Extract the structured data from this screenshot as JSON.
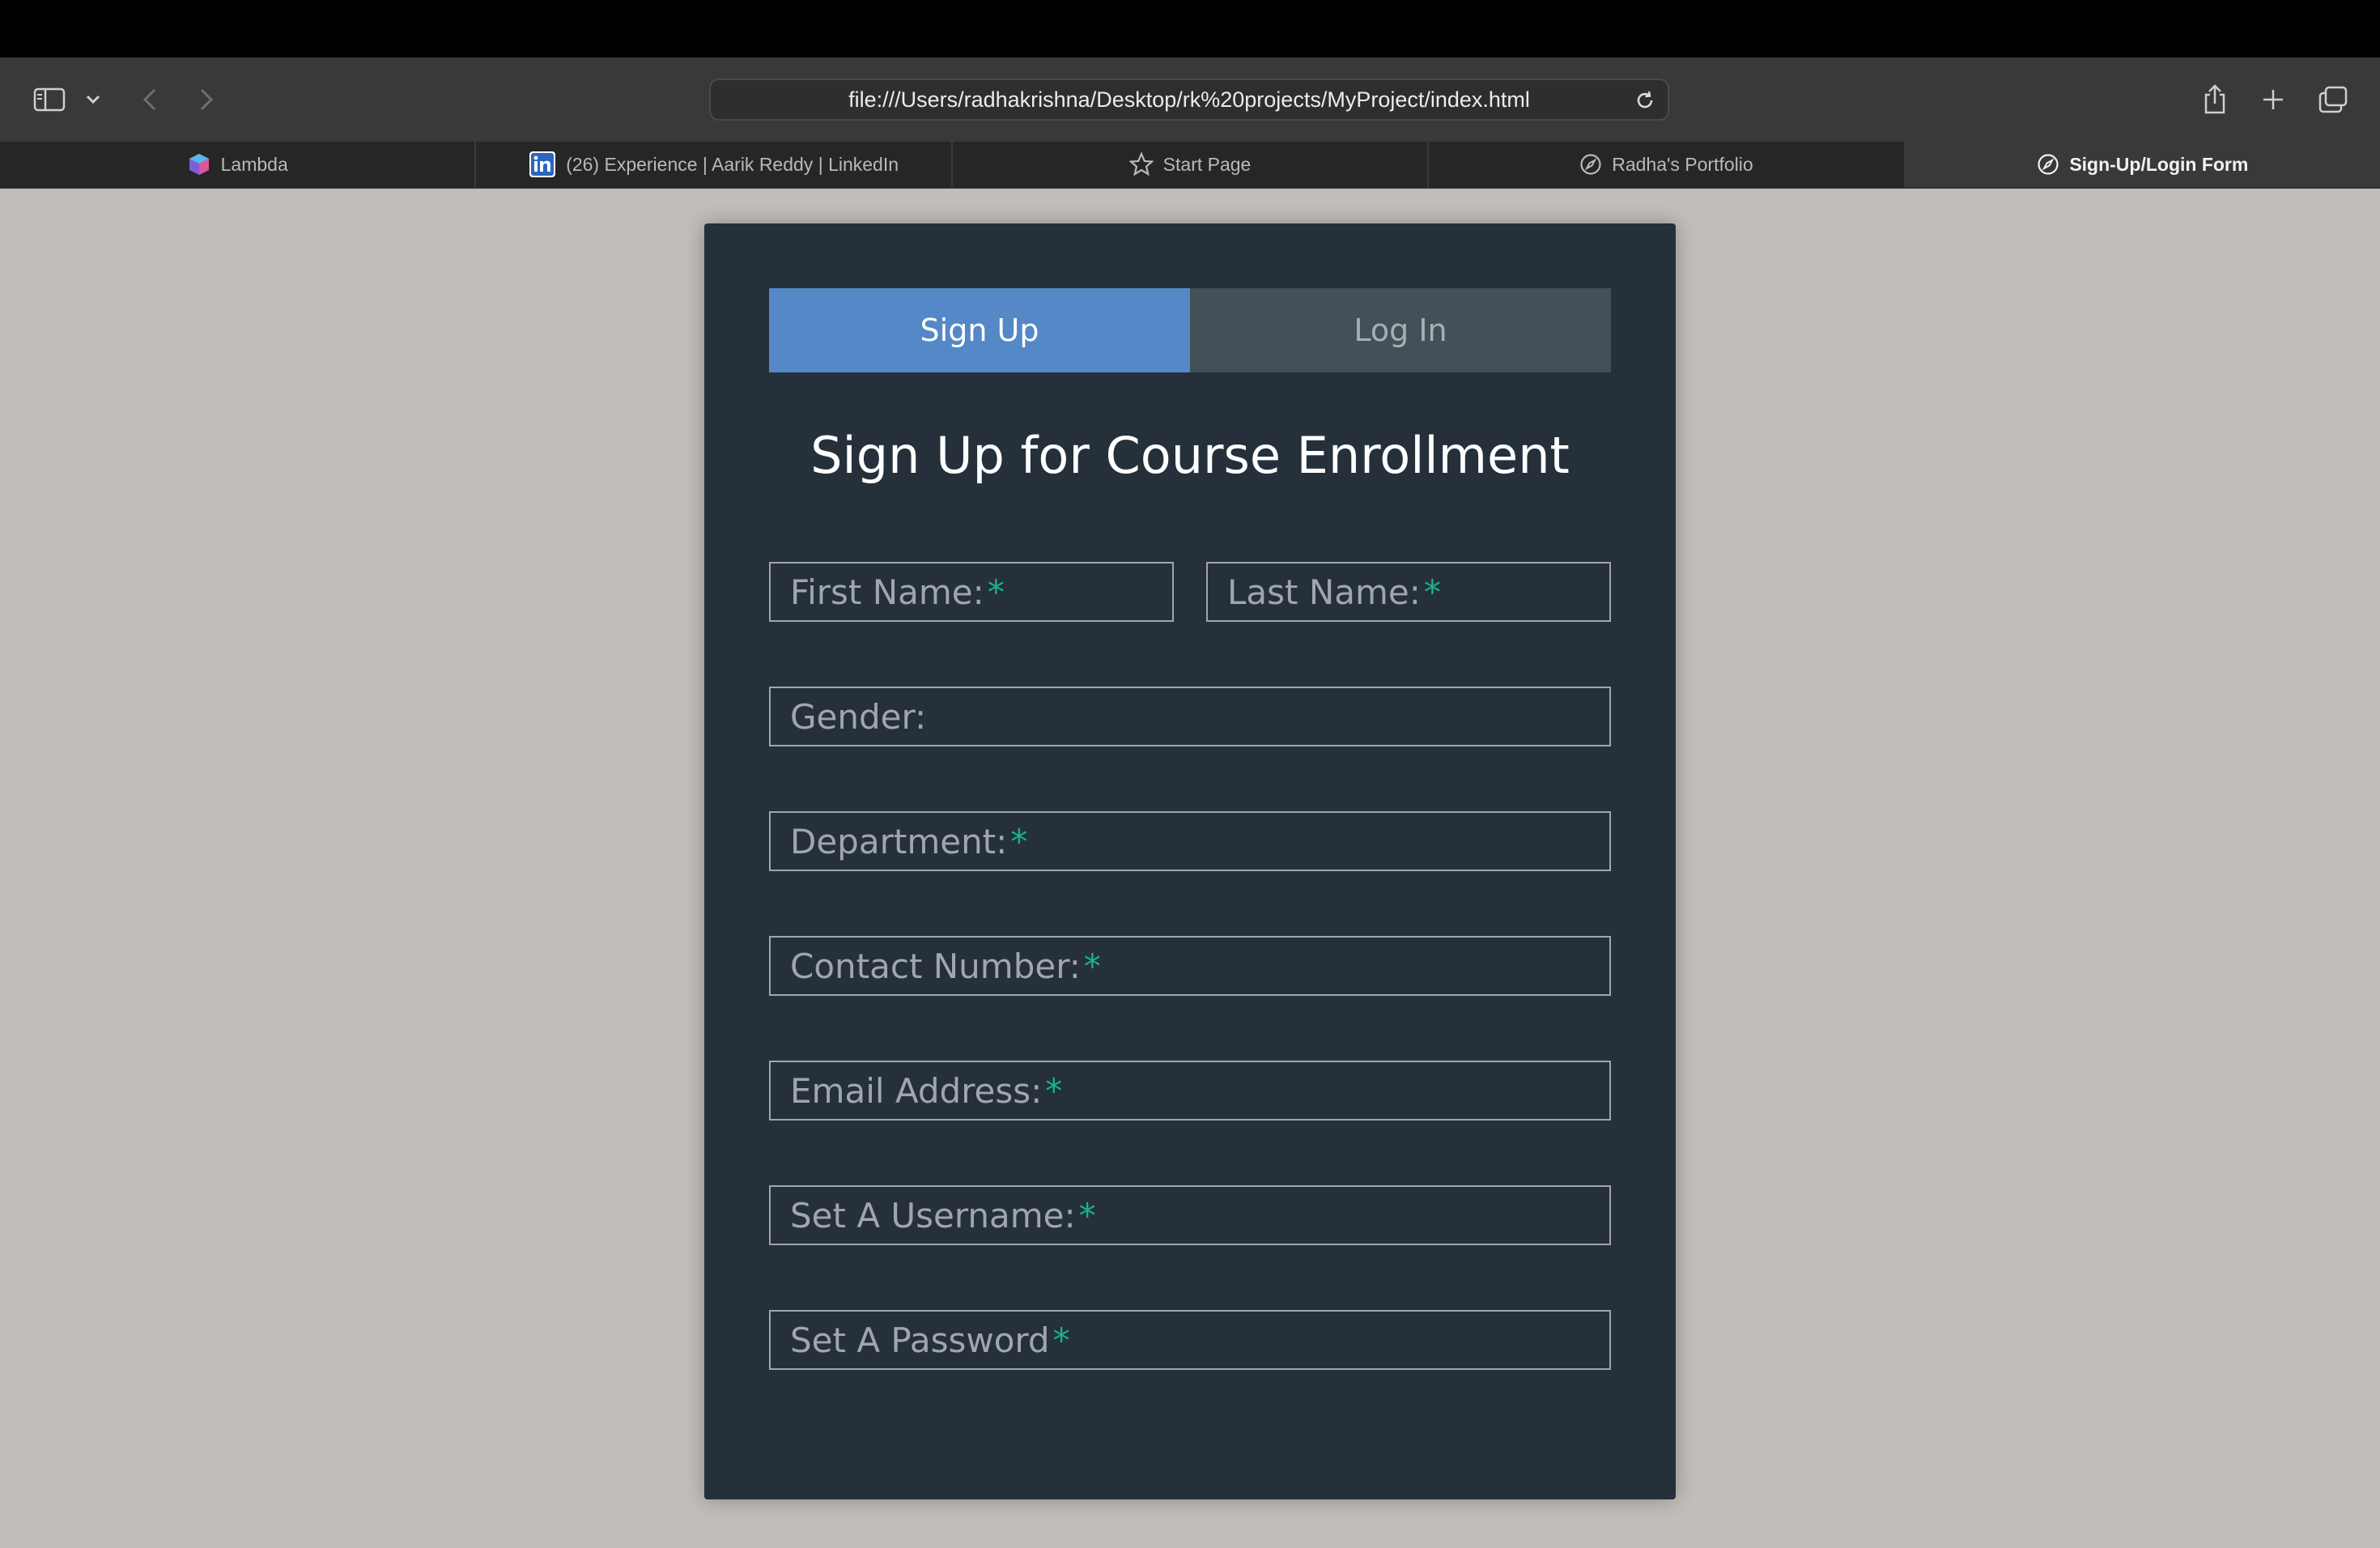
{
  "browser": {
    "url": "file:///Users/radhakrishna/Desktop/rk%20projects/MyProject/index.html",
    "tabs": [
      {
        "label": "Lambda",
        "icon": "lambda-cube-icon",
        "active": false
      },
      {
        "label": "(26) Experience | Aarik Reddy | LinkedIn",
        "icon": "linkedin-icon",
        "active": false
      },
      {
        "label": "Start Page",
        "icon": "star-icon",
        "active": false
      },
      {
        "label": "Radha's Portfolio",
        "icon": "compass-icon",
        "active": false
      },
      {
        "label": "Sign-Up/Login Form",
        "icon": "compass-icon",
        "active": true
      }
    ]
  },
  "form": {
    "tabs": {
      "signup": "Sign Up",
      "login": "Log In"
    },
    "title": "Sign Up for Course Enrollment",
    "required_mark": "*",
    "fields": {
      "first_name": "First Name:",
      "last_name": "Last Name:",
      "gender": "Gender:",
      "department": "Department:",
      "contact": "Contact Number:",
      "email": "Email Address:",
      "username": "Set A Username:",
      "password": "Set A Password"
    }
  },
  "colors": {
    "page_bg": "#c1bdb9",
    "card_bg": "#25303b",
    "active_tab": "#5588c6",
    "inactive_tab": "#435058",
    "required": "#1ab188"
  }
}
